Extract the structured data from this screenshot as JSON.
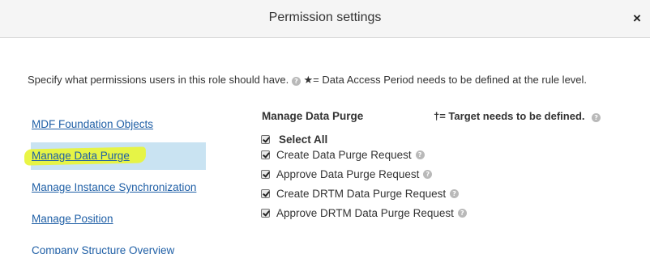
{
  "dialog": {
    "title": "Permission settings",
    "close_glyph": "×"
  },
  "description": {
    "text_before": "Specify what permissions users in this role should have.",
    "text_after": "★= Data Access Period needs to be defined at the rule level."
  },
  "nav": {
    "items": [
      {
        "label": "MDF Foundation Objects"
      },
      {
        "label": "Manage Data Purge",
        "selected": true
      },
      {
        "label": "Manage Instance Synchronization"
      },
      {
        "label": "Manage Position"
      },
      {
        "label": "Company Structure Overview"
      }
    ]
  },
  "panel": {
    "title": "Manage Data Purge",
    "note": "†= Target needs to be defined.",
    "select_all": {
      "label": "Select All",
      "checked": true
    },
    "permissions": [
      {
        "label": "Create Data Purge Request",
        "checked": true
      },
      {
        "label": "Approve Data Purge Request",
        "checked": true
      },
      {
        "label": "Create DRTM Data Purge Request",
        "checked": true
      },
      {
        "label": "Approve DRTM Data Purge Request",
        "checked": true
      }
    ]
  },
  "icons": {
    "help": "question-circle-icon",
    "close": "close-icon",
    "checkbox": "checkmark-icon"
  },
  "colors": {
    "link": "#1f5fa6",
    "selected_bg": "#c9e3f2",
    "highlighter": "#e8f43c",
    "header_bg": "#f5f5f5"
  }
}
